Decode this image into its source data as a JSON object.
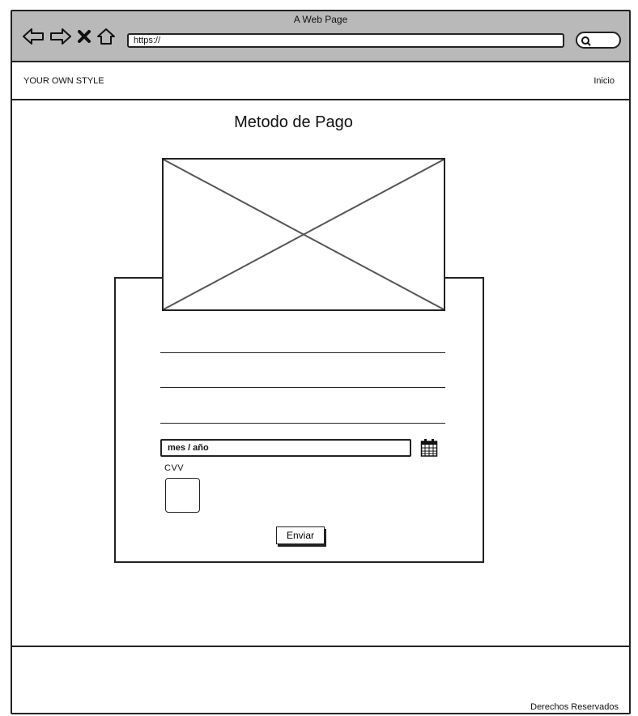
{
  "window": {
    "title": "A Web Page"
  },
  "address_bar": {
    "url": "https://"
  },
  "icons": [
    "back-arrow-icon",
    "forward-arrow-icon",
    "close-icon",
    "home-icon",
    "search-icon",
    "calendar-icon"
  ],
  "header": {
    "brand": "YOUR OWN STYLE",
    "nav_link": "Inicio"
  },
  "main": {
    "title": "Metodo de Pago",
    "form": {
      "expiry_placeholder": "mes / año",
      "cvv_label": "CVV",
      "submit_label": "Enviar"
    }
  },
  "footer": {
    "text": "Derechos Reservados"
  },
  "colors": {
    "chrome": "#b9b9b9",
    "stroke": "#222222",
    "background": "#ffffff"
  }
}
